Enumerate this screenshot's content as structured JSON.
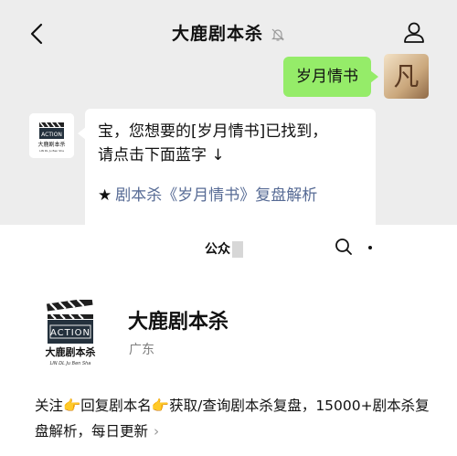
{
  "header": {
    "title": "大鹿剧本杀",
    "back_icon": "chevron-left-icon",
    "mute_icon": "bell-off-icon",
    "profile_icon": "person-icon"
  },
  "messages": {
    "outgoing": {
      "text": "岁月情书",
      "bubble_color": "#95ec69",
      "avatar_glyph": "凡"
    },
    "incoming": {
      "line1": "宝，您想要的[岁月情书]已找到，",
      "line2": "请点击下面蓝字 ↓",
      "link_star": "★",
      "link_text": "剧本杀《岁月情书》复盘解析",
      "link_color": "#576b95"
    }
  },
  "account_card": {
    "header_title": "公众",
    "search_icon": "search-icon",
    "more_icon": "more-dot-icon",
    "logo": {
      "clapper_text": "ACTION",
      "cn_text": "大鹿剧本杀",
      "en_text": "LIN DL Ju Ben Sha"
    },
    "name": "大鹿剧本杀",
    "location": "广东",
    "description": "关注👉回复剧本名👉获取/查询剧本杀复盘，15000+剧本杀复盘解析，每日更新",
    "chevron": "›"
  }
}
